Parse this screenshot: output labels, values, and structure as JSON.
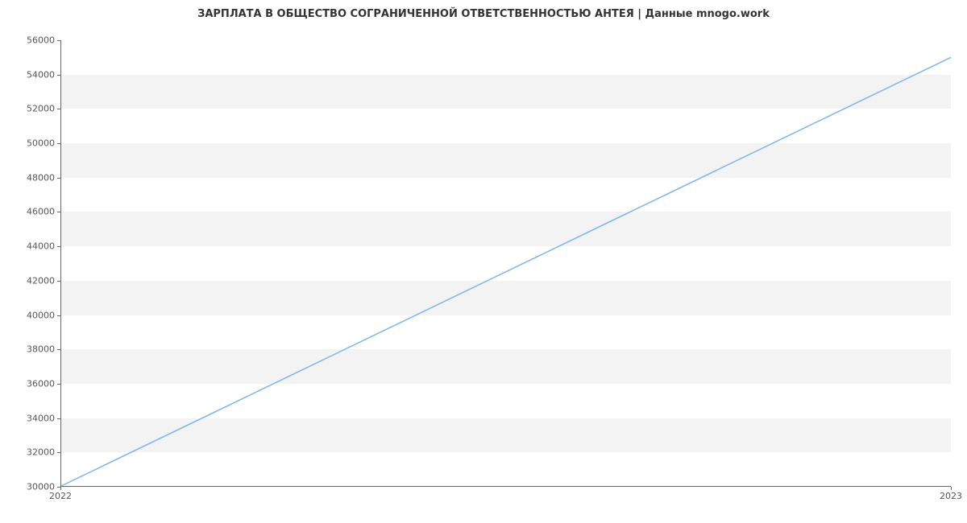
{
  "chart_data": {
    "type": "line",
    "title": "ЗАРПЛАТА В ОБЩЕСТВО СОГРАНИЧЕННОЙ ОТВЕТСТВЕННОСТЬЮ АНТЕЯ | Данные mnogo.work",
    "x": [
      "2022",
      "2023"
    ],
    "series": [
      {
        "name": "salary",
        "values": [
          30000,
          55000
        ],
        "color": "#7cb5ec"
      }
    ],
    "xlabel": "",
    "ylabel": "",
    "ylim": [
      30000,
      56000
    ],
    "yticks": [
      30000,
      32000,
      34000,
      36000,
      38000,
      40000,
      42000,
      44000,
      46000,
      48000,
      50000,
      52000,
      54000,
      56000
    ],
    "xticks": [
      "2022",
      "2023"
    ],
    "grid": true
  }
}
